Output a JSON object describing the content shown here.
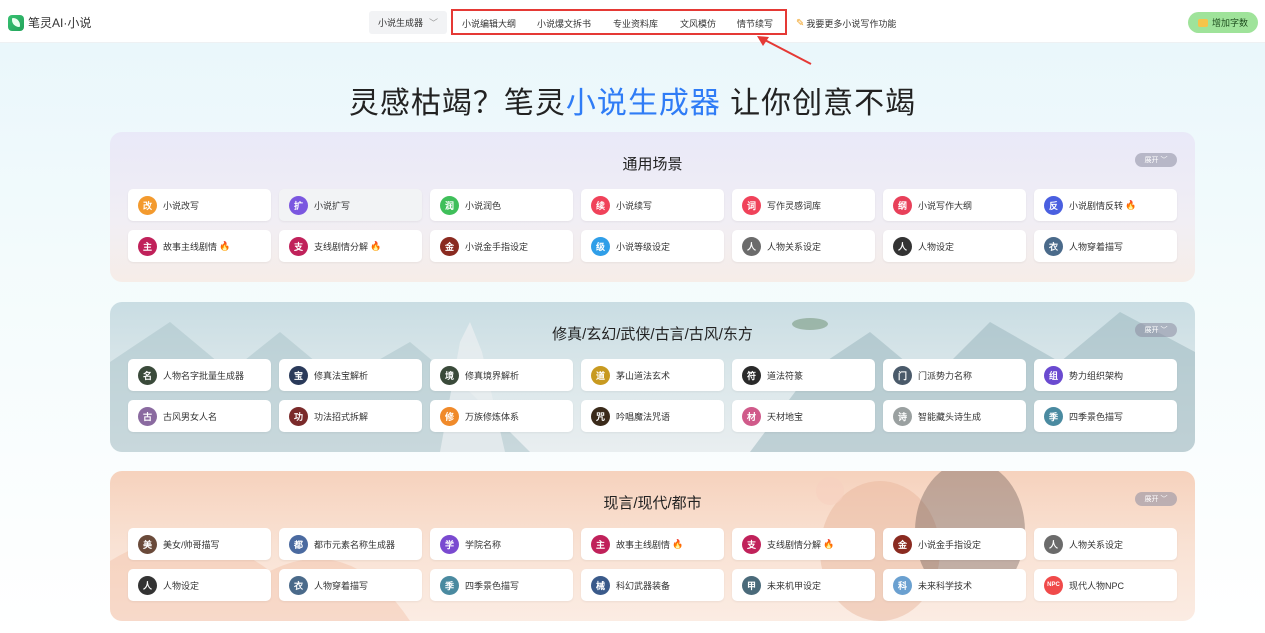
{
  "app": {
    "title": "笔灵AI·小说"
  },
  "nav": {
    "select_label": "小说生成器",
    "items": [
      "小说编辑大纲",
      "小说爆文拆书",
      "专业资料库",
      "文风模仿",
      "情节续写"
    ],
    "more": "我要更多小说写作功能",
    "add_button": "增加字数"
  },
  "hero": {
    "pre": "灵感枯竭？笔灵",
    "accent": "小说生成器",
    "post": " 让你创意不竭"
  },
  "expand_label": "展开",
  "sections": [
    {
      "title": "通用场景",
      "cards": [
        {
          "label": "小说改写",
          "icon": "rewrite-icon",
          "color": "#f39a2e",
          "glyph": "改"
        },
        {
          "label": "小说扩写",
          "icon": "expand-icon",
          "color": "#7b57e0",
          "glyph": "扩"
        },
        {
          "label": "小说润色",
          "icon": "polish-icon",
          "color": "#3fbf5a",
          "glyph": "润"
        },
        {
          "label": "小说续写",
          "icon": "continue-icon",
          "color": "#f0425a",
          "glyph": "续"
        },
        {
          "label": "写作灵感词库",
          "icon": "word-bank-icon",
          "color": "#f0425a",
          "glyph": "词"
        },
        {
          "label": "小说写作大纲",
          "icon": "outline-icon",
          "color": "#e8405a",
          "glyph": "纲"
        },
        {
          "label": "小说剧情反转",
          "icon": "twist-icon",
          "color": "#4a5fe0",
          "glyph": "反"
        },
        {
          "label": "故事主线剧情",
          "icon": "main-plot-icon",
          "color": "#c0215a",
          "glyph": "主"
        },
        {
          "label": "支线剧情分解",
          "icon": "subplot-icon",
          "color": "#c0215a",
          "glyph": "支"
        },
        {
          "label": "小说金手指设定",
          "icon": "golden-finger-icon",
          "color": "#8a2a20",
          "glyph": "金"
        },
        {
          "label": "小说等级设定",
          "icon": "level-icon",
          "color": "#2f9ee8",
          "glyph": "级"
        },
        {
          "label": "人物关系设定",
          "icon": "relationship-icon",
          "color": "#6b6b6b",
          "glyph": "人"
        },
        {
          "label": "人物设定",
          "icon": "character-icon",
          "color": "#333333",
          "glyph": "人"
        },
        {
          "label": "人物穿着描写",
          "icon": "clothing-icon",
          "color": "#4a6a8a",
          "glyph": "衣"
        }
      ],
      "flames": [
        6,
        7,
        8
      ]
    },
    {
      "title": "修真/玄幻/武侠/古言/古风/东方",
      "cards": [
        {
          "label": "人物名字批量生成器",
          "icon": "name-generator-icon",
          "color": "#3a4a3a",
          "glyph": "名"
        },
        {
          "label": "修真法宝解析",
          "icon": "treasure-icon",
          "color": "#2a3a5a",
          "glyph": "宝"
        },
        {
          "label": "修真境界解析",
          "icon": "realm-icon",
          "color": "#3a4a3a",
          "glyph": "境"
        },
        {
          "label": "茅山道法玄术",
          "icon": "taoism-icon",
          "color": "#c89a20",
          "glyph": "道"
        },
        {
          "label": "道法符篆",
          "icon": "talisman-icon",
          "color": "#2a2a2a",
          "glyph": "符"
        },
        {
          "label": "门派势力名称",
          "icon": "sect-icon",
          "color": "#4a5a6a",
          "glyph": "门"
        },
        {
          "label": "势力组织架构",
          "icon": "organization-icon",
          "color": "#6a4ad0",
          "glyph": "组"
        },
        {
          "label": "古风男女人名",
          "icon": "ancient-name-icon",
          "color": "#8a6aa0",
          "glyph": "古"
        },
        {
          "label": "功法招式拆解",
          "icon": "martial-arts-icon",
          "color": "#7a2a2a",
          "glyph": "功"
        },
        {
          "label": "万族修炼体系",
          "icon": "cultivation-icon",
          "color": "#f08a2a",
          "glyph": "修"
        },
        {
          "label": "吟唱魔法咒语",
          "icon": "spell-icon",
          "color": "#3a2a1a",
          "glyph": "咒"
        },
        {
          "label": "天材地宝",
          "icon": "natural-treasure-icon",
          "color": "#d05a8a",
          "glyph": "材"
        },
        {
          "label": "智能藏头诗生成",
          "icon": "poem-icon",
          "color": "#9aa0a0",
          "glyph": "诗"
        },
        {
          "label": "四季景色描写",
          "icon": "season-icon",
          "color": "#4a8aa0",
          "glyph": "季"
        }
      ],
      "flames": []
    },
    {
      "title": "现言/现代/都市",
      "cards": [
        {
          "label": "美女/帅哥描写",
          "icon": "portrait-icon",
          "color": "#6a4a3a",
          "glyph": "美"
        },
        {
          "label": "都市元素名称生成器",
          "icon": "city-icon",
          "color": "#4a6aa0",
          "glyph": "都"
        },
        {
          "label": "学院名称",
          "icon": "academy-icon",
          "color": "#7a4ad0",
          "glyph": "学"
        },
        {
          "label": "故事主线剧情",
          "icon": "main-plot-icon",
          "color": "#c0215a",
          "glyph": "主"
        },
        {
          "label": "支线剧情分解",
          "icon": "subplot-icon",
          "color": "#c0215a",
          "glyph": "支"
        },
        {
          "label": "小说金手指设定",
          "icon": "golden-finger-icon",
          "color": "#8a2a20",
          "glyph": "金"
        },
        {
          "label": "人物关系设定",
          "icon": "relationship-icon",
          "color": "#6b6b6b",
          "glyph": "人"
        },
        {
          "label": "人物设定",
          "icon": "character-icon",
          "color": "#333333",
          "glyph": "人"
        },
        {
          "label": "人物穿着描写",
          "icon": "clothing-icon",
          "color": "#4a6a8a",
          "glyph": "衣"
        },
        {
          "label": "四季景色描写",
          "icon": "season-icon",
          "color": "#4a8aa0",
          "glyph": "季"
        },
        {
          "label": "科幻武器装备",
          "icon": "scifi-weapon-icon",
          "color": "#3a5a8a",
          "glyph": "械"
        },
        {
          "label": "未来机甲设定",
          "icon": "mecha-icon",
          "color": "#4a6a7a",
          "glyph": "甲"
        },
        {
          "label": "未来科学技术",
          "icon": "technology-icon",
          "color": "#6aa0d0",
          "glyph": "科"
        },
        {
          "label": "现代人物NPC",
          "icon": "npc-icon",
          "color": "#f04a4a",
          "glyph": "NPC"
        }
      ],
      "flames": [
        3,
        4
      ]
    }
  ]
}
